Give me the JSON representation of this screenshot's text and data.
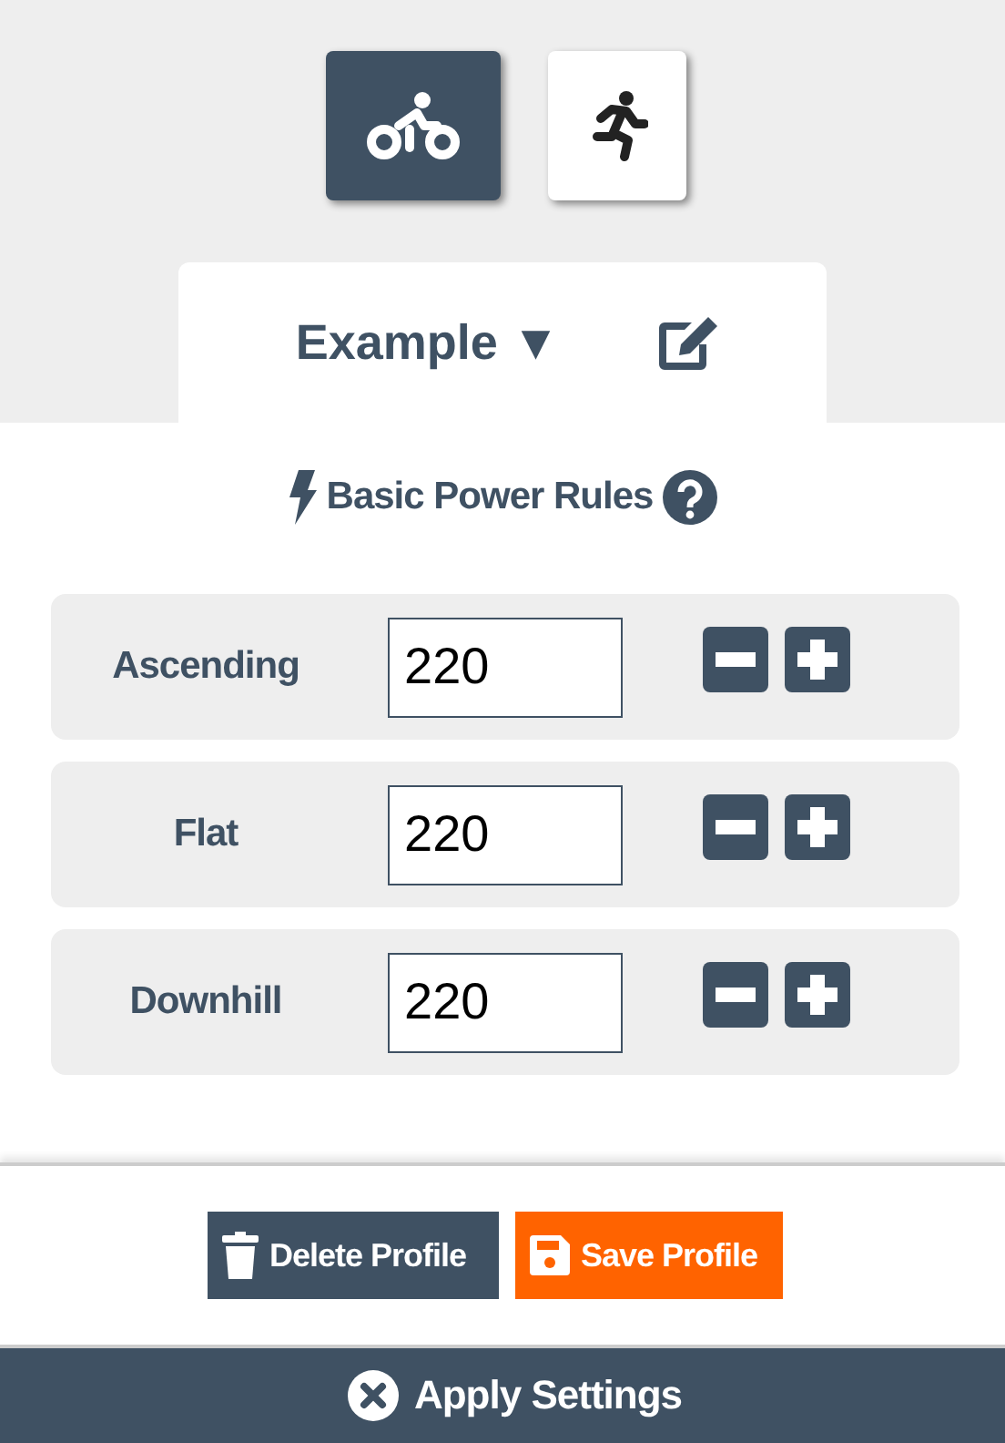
{
  "sports": [
    {
      "kind": "bike",
      "selected": true
    },
    {
      "kind": "run",
      "selected": false
    }
  ],
  "profile": {
    "name": "Example",
    "caret": "▼"
  },
  "section": {
    "title": "Basic Power Rules"
  },
  "rules": [
    {
      "label": "Ascending",
      "value": "220"
    },
    {
      "label": "Flat",
      "value": "220"
    },
    {
      "label": "Downhill",
      "value": "220"
    }
  ],
  "buttons": [
    {
      "kind": "delete",
      "label": "Delete Profile"
    },
    {
      "kind": "save",
      "label": "Save Profile"
    }
  ],
  "apply": {
    "label": "Apply Settings"
  }
}
